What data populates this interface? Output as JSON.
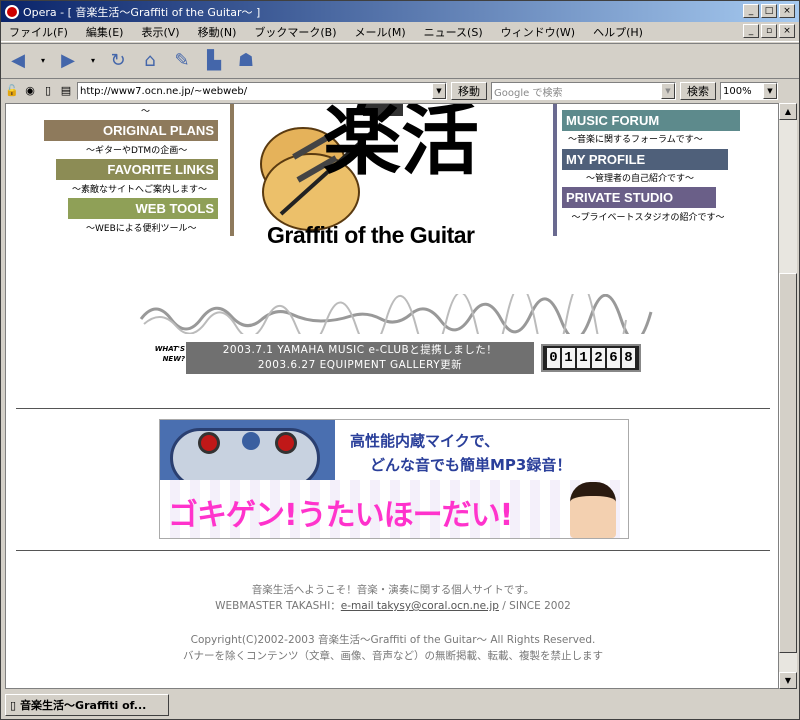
{
  "window": {
    "title": "Opera - [ 音楽生活～Graffiti of the Guitar～ ]"
  },
  "menu": [
    "ファイル(F)",
    "編集(E)",
    "表示(V)",
    "移動(N)",
    "ブックマーク(B)",
    "メール(M)",
    "ニュース(S)",
    "ウィンドウ(W)",
    "ヘルプ(H)"
  ],
  "address": {
    "url": "http://www7.ocn.ne.jp/~webweb/",
    "go_label": "移動",
    "search_placeholder": "Google で検索",
    "search_label": "検索",
    "zoom": "100%"
  },
  "nav_left": [
    {
      "label": "ORIGINAL PLANS",
      "desc": "～ギターやDTMの企画～"
    },
    {
      "label": "FAVORITE LINKS",
      "desc": "～素敵なサイトへご案内します～"
    },
    {
      "label": "WEB TOOLS",
      "desc": "～WEBによる便利ツール～"
    }
  ],
  "nav_left_top_desc": "～",
  "nav_right": [
    {
      "label": "MUSIC FORUM",
      "desc": "～音楽に関するフォーラムです～"
    },
    {
      "label": "MY PROFILE",
      "desc": "～管理者の自己紹介です～"
    },
    {
      "label": "PRIVATE STUDIO",
      "desc": "～プライベートスタジオの紹介です～"
    }
  ],
  "logo": {
    "kanji": "楽活",
    "subtitle": "Graffiti of the Guitar"
  },
  "whats_new_label": "WHAT'S NEW?",
  "news": [
    "2003.7.1 YAMAHA MUSIC e-CLUBと提携しました！",
    "2003.6.27 EQUIPMENT GALLERY更新"
  ],
  "counter": [
    "0",
    "1",
    "1",
    "2",
    "6",
    "8"
  ],
  "ad": {
    "line1": "高性能内蔵マイクで、",
    "line2": "どんな音でも簡単MP3録音！",
    "banner": "ゴキゲン!うたいほーだい!"
  },
  "footer": {
    "line1": "音楽生活へようこそ！音楽・演奏に関する個人サイトです。",
    "webmaster": "WEBMASTER TAKASHI：",
    "mail": "e-mail takysy@coral.ocn.ne.jp",
    "since": " / SINCE 2002",
    "copyright": "Copyright(C)2002-2003 音楽生活～Graffiti of the Guitar～ All Rights Reserved.",
    "notice": "バナーを除くコンテンツ（文章、画像、音声など）の無断掲載、転載、複製を禁止します"
  },
  "status_tab": "音楽生活～Graffiti of...",
  "colors": {
    "nav_brown": "#8e7a5c",
    "nav_olive": "#8c8c55",
    "nav_green": "#8fa057",
    "nav_teal": "#5d8a8c",
    "nav_slate": "#4f607a",
    "nav_purple": "#6a5f88"
  }
}
